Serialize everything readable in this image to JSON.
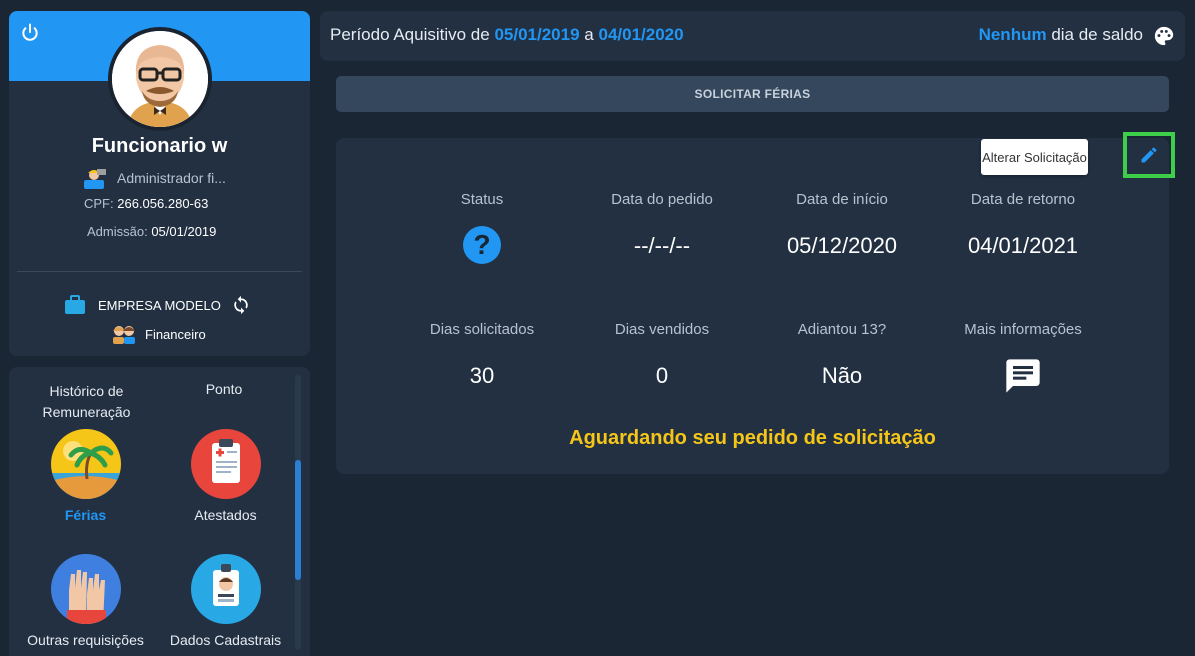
{
  "profile": {
    "name": "Funcionario w",
    "role": "Administrador fi...",
    "cpf_label": "CPF:",
    "cpf_value": "266.056.280-63",
    "admissao_label": "Admissão:",
    "admissao_value": "05/01/2019",
    "company": "EMPRESA MODELO",
    "department": "Financeiro"
  },
  "menu": {
    "items": [
      {
        "label": "Histórico de Remuneração"
      },
      {
        "label": "Ponto"
      },
      {
        "label": "Férias"
      },
      {
        "label": "Atestados"
      },
      {
        "label": "Outras requisições"
      },
      {
        "label": "Dados Cadastrais"
      }
    ]
  },
  "header": {
    "period_prefix": "Período Aquisitivo de",
    "period_start": "05/01/2019",
    "period_joiner": "a",
    "period_end": "04/01/2020",
    "saldo_highlight": "Nenhum",
    "saldo_suffix": "dia de saldo"
  },
  "actions": {
    "solicitar": "SOLICITAR FÉRIAS",
    "alterar": "Alterar Solicitação"
  },
  "request": {
    "status_label": "Status",
    "status_icon": "?",
    "data_pedido_label": "Data do pedido",
    "data_pedido_value": "--/--/--",
    "data_inicio_label": "Data de início",
    "data_inicio_value": "05/12/2020",
    "data_retorno_label": "Data de retorno",
    "data_retorno_value": "04/01/2021",
    "dias_solicitados_label": "Dias solicitados",
    "dias_solicitados_value": "30",
    "dias_vendidos_label": "Dias vendidos",
    "dias_vendidos_value": "0",
    "adiantou_label": "Adiantou 13?",
    "adiantou_value": "Não",
    "mais_info_label": "Mais informações",
    "message": "Aguardando seu pedido de solicitação"
  },
  "colors": {
    "accent": "#2196f3",
    "warning": "#f5c518",
    "background": "#1b2634",
    "card": "#223042",
    "highlight_box": "#3ecf4a"
  },
  "icons": {
    "power": "power-icon",
    "palette": "palette-icon",
    "edit": "pencil-icon",
    "status": "question-circle-icon",
    "info": "chat-bubble-icon",
    "company": "briefcase-icon",
    "refresh": "refresh-icon"
  }
}
